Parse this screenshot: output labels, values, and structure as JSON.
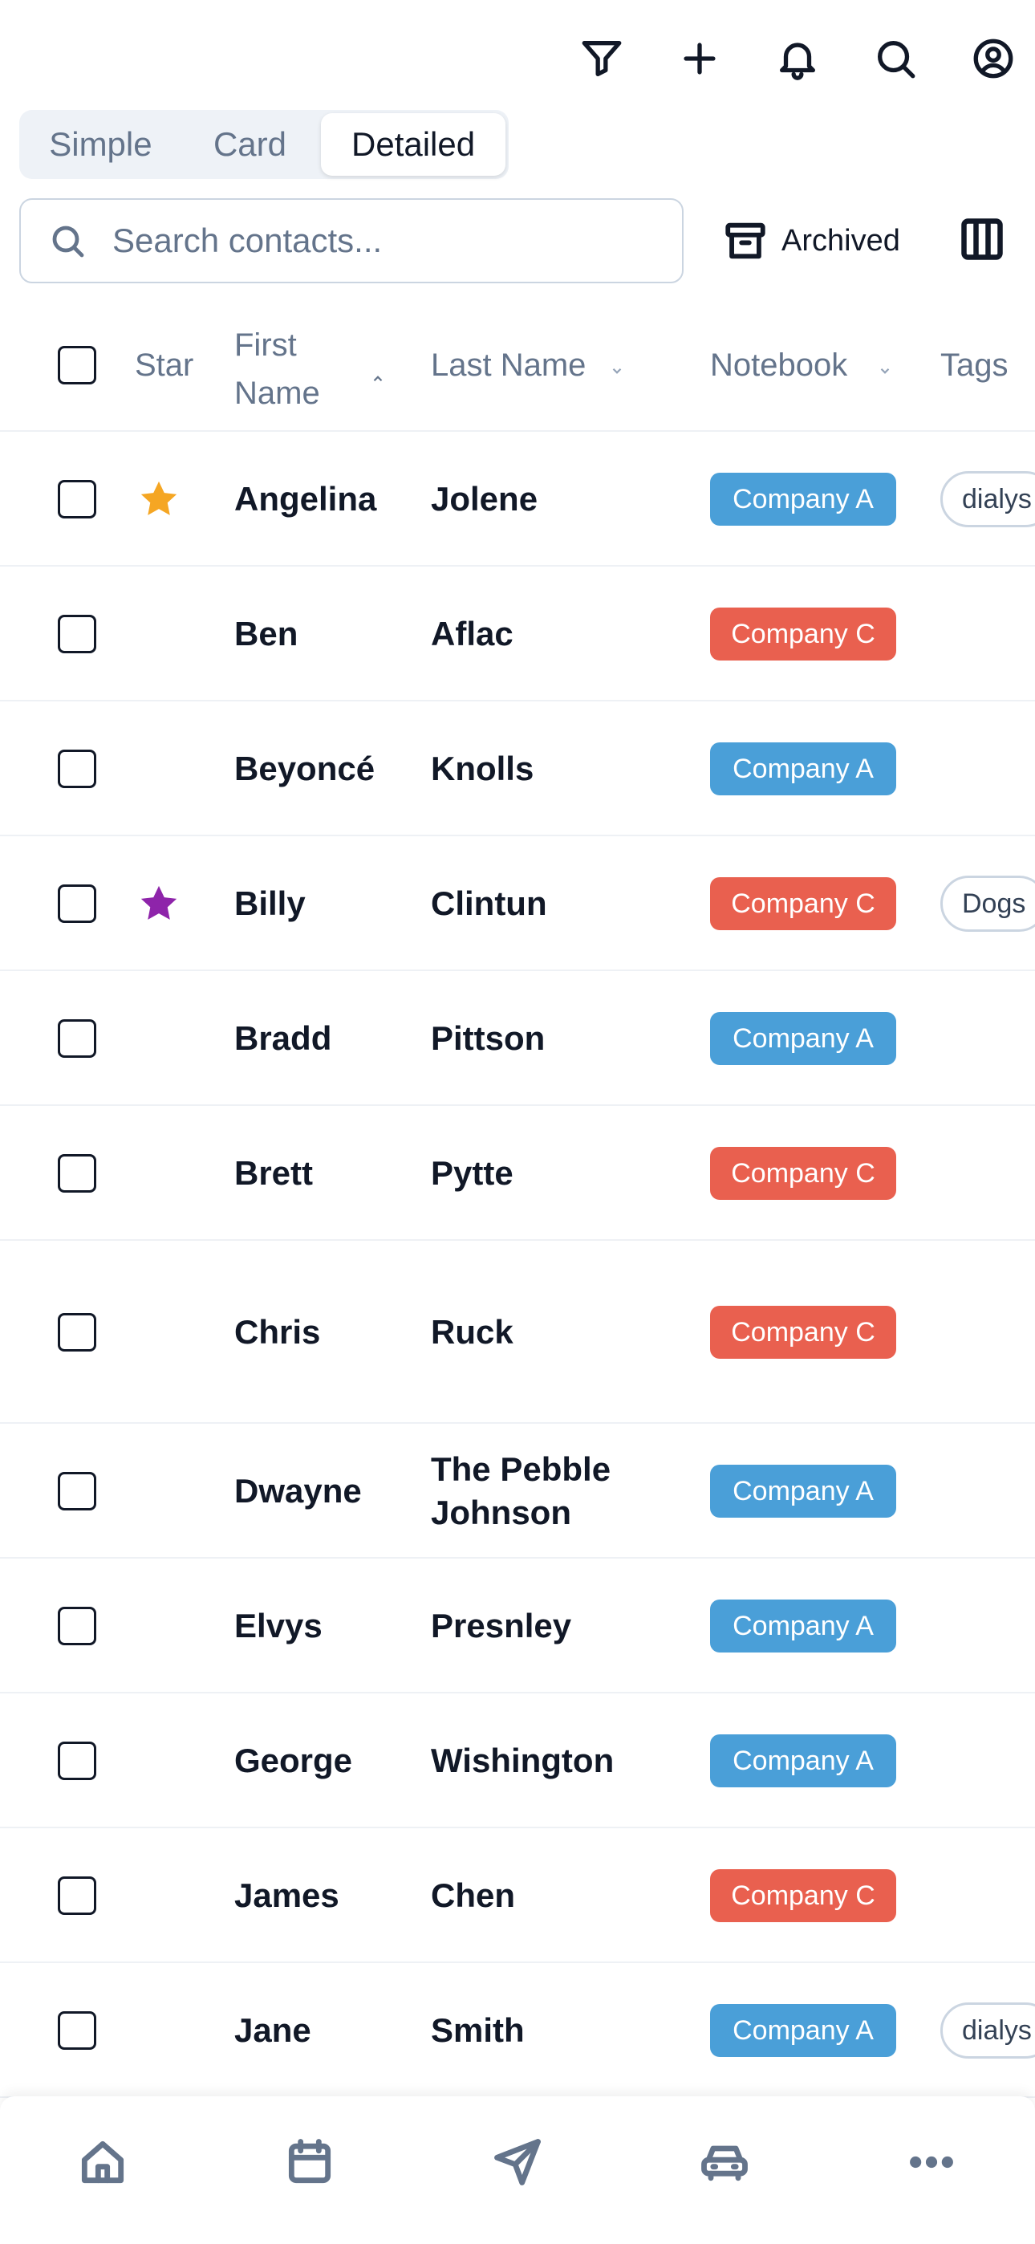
{
  "view_switch": {
    "options": [
      "Simple",
      "Card",
      "Detailed"
    ],
    "selected": "Detailed"
  },
  "search": {
    "placeholder": "Search contacts...",
    "value": ""
  },
  "toolbar": {
    "archived_label": "Archived"
  },
  "topbar_icons": [
    "filter-icon",
    "plus-icon",
    "bell-icon",
    "search-icon",
    "user-circle-icon"
  ],
  "table": {
    "headers": {
      "star": "Star",
      "first_name": "First Name",
      "last_name": "Last Name",
      "notebook": "Notebook",
      "tags": "Tags"
    },
    "sort": {
      "column": "First Name",
      "direction": "ascending"
    },
    "rows": [
      {
        "first": "Angelina",
        "last": "Jolene",
        "notebook": "Company A",
        "star": "orange",
        "tag": "dialys"
      },
      {
        "first": "Ben",
        "last": "Aflac",
        "notebook": "Company C",
        "star": null,
        "tag": null
      },
      {
        "first": "Beyoncé",
        "last": "Knolls",
        "notebook": "Company A",
        "star": null,
        "tag": null
      },
      {
        "first": "Billy",
        "last": "Clintun",
        "notebook": "Company C",
        "star": "purple",
        "tag": "Dogs"
      },
      {
        "first": "Bradd",
        "last": "Pittson",
        "notebook": "Company A",
        "star": null,
        "tag": null
      },
      {
        "first": "Brett",
        "last": "Pytte",
        "notebook": "Company C",
        "star": null,
        "tag": null
      },
      {
        "first": "Chris",
        "last": "Ruck",
        "notebook": "Company C",
        "star": null,
        "tag": null
      },
      {
        "first": "Dwayne",
        "last": "The Pebble Johnson",
        "notebook": "Company A",
        "star": null,
        "tag": null
      },
      {
        "first": "Elvys",
        "last": "Presnley",
        "notebook": "Company A",
        "star": null,
        "tag": null
      },
      {
        "first": "George",
        "last": "Wishington",
        "notebook": "Company A",
        "star": null,
        "tag": null
      },
      {
        "first": "James",
        "last": "Chen",
        "notebook": "Company C",
        "star": null,
        "tag": null
      },
      {
        "first": "Jane",
        "last": "Smith",
        "notebook": "Company A",
        "star": null,
        "tag": "dialys"
      }
    ]
  },
  "colors": {
    "company_a": "#4a9fd8",
    "company_c": "#e9604f",
    "star_orange": "#f5a623",
    "star_purple": "#8e24aa"
  },
  "bottom_nav": [
    "home-icon",
    "calendar-icon",
    "send-icon",
    "car-icon",
    "more-icon"
  ]
}
